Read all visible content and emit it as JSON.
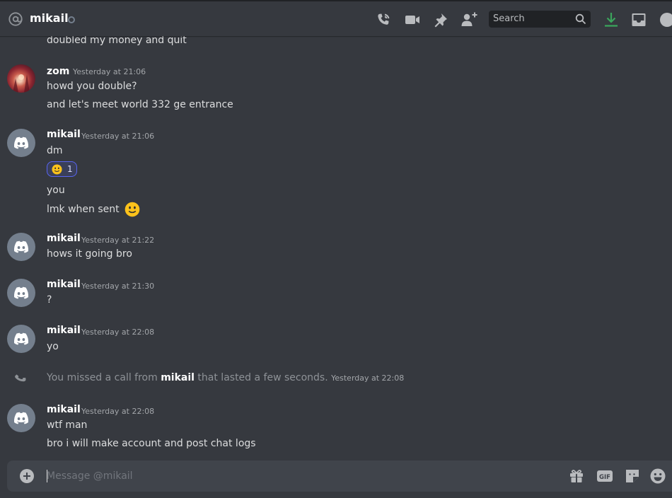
{
  "header": {
    "channel_name": "mikail",
    "search_placeholder": "Search",
    "icons": [
      "at-icon",
      "voice-call-icon",
      "video-call-icon",
      "pin-icon",
      "add-friend-icon",
      "search-icon",
      "download-icon",
      "inbox-icon",
      "help-icon"
    ],
    "download_color": "#3ba55c"
  },
  "messages": {
    "partial_text": "doubled my money and quit",
    "group1": {
      "author": "zom",
      "timestamp": "Yesterday at 21:06",
      "lines": [
        "howd you double?",
        "and let's meet world 332 ge entrance"
      ]
    },
    "group2": {
      "author": "mikail",
      "timestamp": "Yesterday at 21:06",
      "lines": [
        "dm",
        "you",
        "lmk when sent"
      ],
      "reaction": {
        "emoji": "slightly-smiling-face",
        "count": "1"
      }
    },
    "group3": {
      "author": "mikail",
      "timestamp": "Yesterday at 21:22",
      "lines": [
        "hows it going bro"
      ]
    },
    "group4": {
      "author": "mikail",
      "timestamp": "Yesterday at 21:30",
      "lines": [
        "?"
      ]
    },
    "group5": {
      "author": "mikail",
      "timestamp": "Yesterday at 22:08",
      "lines": [
        "yo"
      ]
    },
    "system": {
      "prefix": "You missed a call from",
      "user": "mikail",
      "suffix": "that lasted a few seconds.",
      "timestamp": "Yesterday at 22:08"
    },
    "group6": {
      "author": "mikail",
      "timestamp": "Yesterday at 22:08",
      "lines": [
        "wtf man",
        "bro i will make account and post chat logs"
      ]
    }
  },
  "composer": {
    "placeholder": "Message @mikail",
    "gif_label": "GIF",
    "icons": [
      "attach-plus-icon",
      "gift-icon",
      "gif-icon",
      "sticker-icon",
      "emoji-icon"
    ]
  },
  "colors": {
    "background": "#36393f",
    "accent": "#5865f2",
    "emoji": "#fcc21b"
  }
}
